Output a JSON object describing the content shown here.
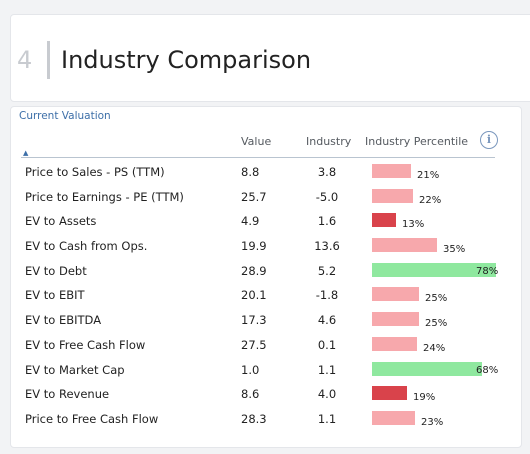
{
  "header": {
    "step_number": "4",
    "title": "Industry Comparison"
  },
  "valuation": {
    "section_label": "Current Valuation",
    "columns": {
      "value": "Value",
      "industry": "Industry",
      "percentile": "Industry Percentile"
    },
    "info_icon": "info-circle-icon",
    "rows": [
      {
        "metric": "Price to Sales - PS (TTM)",
        "value": "8.8",
        "industry": "3.8",
        "percentile": 21,
        "percentile_label": "21%"
      },
      {
        "metric": "Price to Earnings - PE (TTM)",
        "value": "25.7",
        "industry": "-5.0",
        "percentile": 22,
        "percentile_label": "22%"
      },
      {
        "metric": "EV to Assets",
        "value": "4.9",
        "industry": "1.6",
        "percentile": 13,
        "percentile_label": "13%"
      },
      {
        "metric": "EV to Cash from Ops.",
        "value": "19.9",
        "industry": "13.6",
        "percentile": 35,
        "percentile_label": "35%"
      },
      {
        "metric": "EV to Debt",
        "value": "28.9",
        "industry": "5.2",
        "percentile": 78,
        "percentile_label": "78%"
      },
      {
        "metric": "EV to EBIT",
        "value": "20.1",
        "industry": "-1.8",
        "percentile": 25,
        "percentile_label": "25%"
      },
      {
        "metric": "EV to EBITDA",
        "value": "17.3",
        "industry": "4.6",
        "percentile": 25,
        "percentile_label": "25%"
      },
      {
        "metric": "EV to Free Cash Flow",
        "value": "27.5",
        "industry": "0.1",
        "percentile": 24,
        "percentile_label": "24%"
      },
      {
        "metric": "EV to Market Cap",
        "value": "1.0",
        "industry": "1.1",
        "percentile": 68,
        "percentile_label": "68%"
      },
      {
        "metric": "EV to Revenue",
        "value": "8.6",
        "industry": "4.0",
        "percentile": 19,
        "percentile_label": "19%"
      },
      {
        "metric": "Price to Free Cash Flow",
        "value": "28.3",
        "industry": "1.1",
        "percentile": 23,
        "percentile_label": "23%"
      }
    ]
  },
  "colors": {
    "bar_low": "#d9434b",
    "bar_mid": "#f7a8ac",
    "bar_high": "#8fe89f",
    "accent": "#3d6fa8"
  }
}
